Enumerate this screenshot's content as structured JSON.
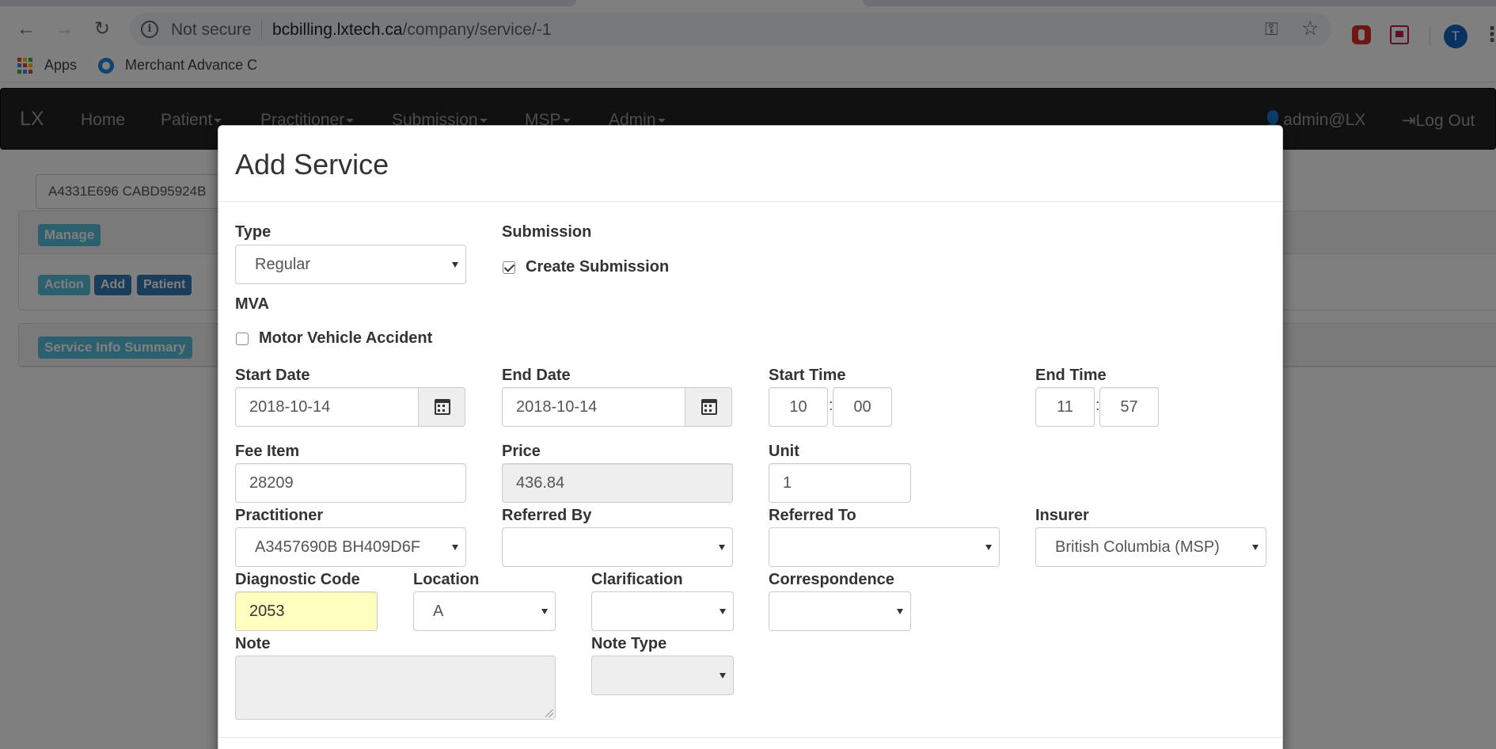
{
  "browser": {
    "security_label": "Not secure",
    "url_host": "bcbilling.lxtech.ca",
    "url_path": "/company/service/-1",
    "avatar_initial": "T",
    "bookmarks": [
      {
        "label": "Apps",
        "icon": "apps-grid-icon"
      },
      {
        "label": "Merchant Advance C",
        "icon": "merchant-advance-icon"
      }
    ]
  },
  "navbar": {
    "brand": "LX",
    "items": [
      "Home",
      "Patient",
      "Practitioner",
      "Submission",
      "MSP",
      "Admin"
    ],
    "user": "admin@LX",
    "logout": "Log Out"
  },
  "page": {
    "patient_input_value": "A4331E696 CABD95924B",
    "manage_label": "Manage",
    "action_label": "Action",
    "add_label": "Add",
    "patient_label": "Patient",
    "summary_label": "Service Info Summary"
  },
  "modal": {
    "title": "Add Service",
    "type": {
      "label": "Type",
      "value": "Regular"
    },
    "submission": {
      "label": "Submission",
      "checkbox_label": "Create Submission",
      "checked": true
    },
    "mva": {
      "label": "MVA",
      "checkbox_label": "Motor Vehicle Accident",
      "checked": false
    },
    "start_date": {
      "label": "Start Date",
      "value": "2018-10-14"
    },
    "end_date": {
      "label": "End Date",
      "value": "2018-10-14"
    },
    "start_time": {
      "label": "Start Time",
      "hour": "10",
      "minute": "00"
    },
    "end_time": {
      "label": "End Time",
      "hour": "11",
      "minute": "57"
    },
    "fee_item": {
      "label": "Fee Item",
      "value": "28209"
    },
    "price": {
      "label": "Price",
      "value": "436.84"
    },
    "unit": {
      "label": "Unit",
      "value": "1"
    },
    "practitioner": {
      "label": "Practitioner",
      "value": "A3457690B BH409D6F"
    },
    "referred_by": {
      "label": "Referred By",
      "value": ""
    },
    "referred_to": {
      "label": "Referred To",
      "value": ""
    },
    "insurer": {
      "label": "Insurer",
      "value": "British Columbia (MSP)"
    },
    "diagnostic_code": {
      "label": "Diagnostic Code",
      "value": "2053"
    },
    "location": {
      "label": "Location",
      "value": "A"
    },
    "clarification": {
      "label": "Clarification",
      "value": ""
    },
    "correspondence": {
      "label": "Correspondence",
      "value": ""
    },
    "note": {
      "label": "Note",
      "value": ""
    },
    "note_type": {
      "label": "Note Type",
      "value": ""
    }
  },
  "colors": {
    "navbar_bg": "#222222",
    "label_info": "#5bc0de",
    "label_primary": "#337ab7",
    "highlight_field": "#ffffc0"
  }
}
